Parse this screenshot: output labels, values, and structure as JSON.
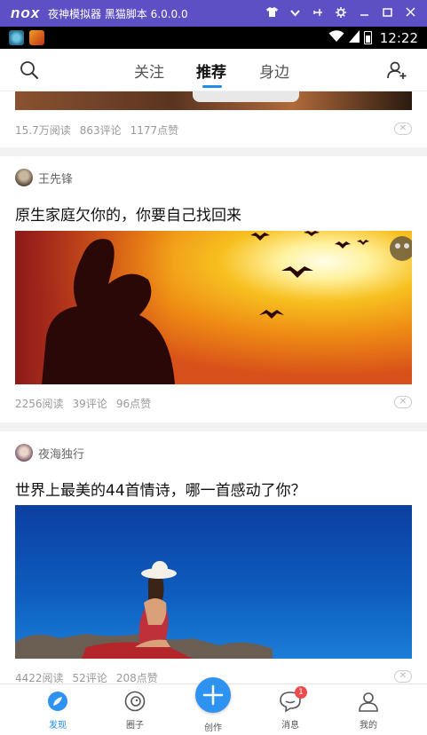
{
  "emulator": {
    "logo": "nox",
    "title": "夜神模拟器 黑猫脚本 6.0.0.0"
  },
  "status_bar": {
    "time": "12:22"
  },
  "header": {
    "tabs": [
      {
        "label": "关注"
      },
      {
        "label": "推荐"
      },
      {
        "label": "身边"
      }
    ]
  },
  "feed": {
    "posts": [
      {
        "stats": {
          "reads": "15.7万阅读",
          "comments": "863评论",
          "likes": "1177点赞"
        }
      },
      {
        "author": "王先锋",
        "title": "原生家庭欠你的，你要自己找回来",
        "stats": {
          "reads": "2256阅读",
          "comments": "39评论",
          "likes": "96点赞"
        }
      },
      {
        "author": "夜海独行",
        "title": "世界上最美的44首情诗，哪一首感动了你？",
        "stats": {
          "reads": "4422阅读",
          "comments": "52评论",
          "likes": "208点赞"
        }
      }
    ]
  },
  "bottom_nav": {
    "items": [
      {
        "label": "发现",
        "icon": "compass-icon"
      },
      {
        "label": "圈子",
        "icon": "circle-icon"
      },
      {
        "label": "创作",
        "icon": "plus-icon"
      },
      {
        "label": "消息",
        "icon": "message-icon",
        "badge": "1"
      },
      {
        "label": "我的",
        "icon": "person-icon"
      }
    ]
  },
  "colors": {
    "accent": "#1e8ce8",
    "emulator_bar": "#5d4fc4",
    "badge": "#f04b4b"
  }
}
